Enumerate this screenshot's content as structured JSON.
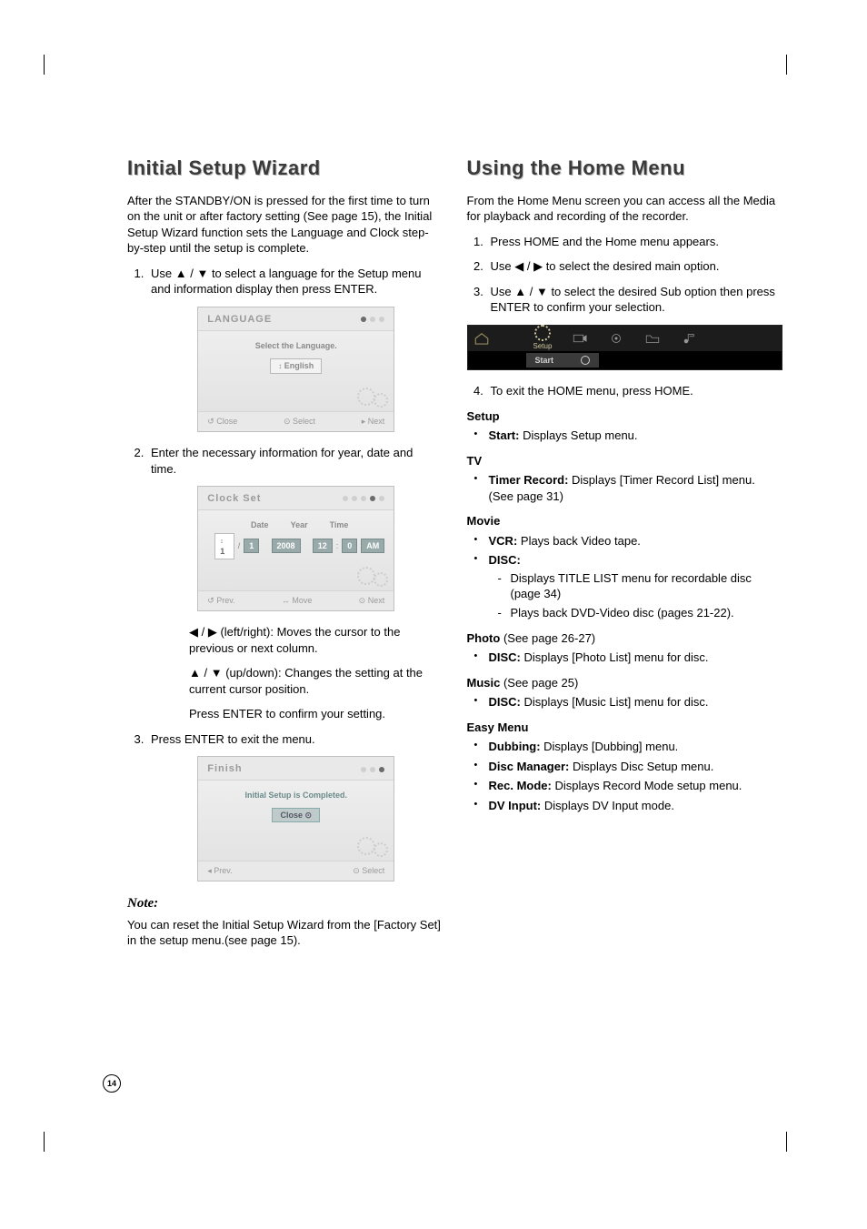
{
  "page_number": "14",
  "left": {
    "title": "Initial Setup Wizard",
    "intro": "After the STANDBY/ON is pressed for the first time to turn on the unit or after factory setting (See page 15), the Initial Setup Wizard function sets the Language and Clock step-by-step until the setup is complete.",
    "step1_a": "Use ",
    "step1_b": " to select a language for the Setup menu and information display then press ENTER.",
    "step2": "Enter the necessary information for year, date and time.",
    "cursor_lr_a": " (left/right): Moves the cursor to the previous or next column.",
    "cursor_ud_a": " (up/down): Changes the setting at the current cursor position.",
    "press_enter_confirm": "Press ENTER to confirm your setting.",
    "step3": "Press ENTER to exit the menu.",
    "note_title": "Note:",
    "note_body": "You can reset the Initial Setup Wizard from the [Factory Set] in the setup menu.(see page 15).",
    "osd1": {
      "title": "LANGUAGE",
      "prompt": "Select the Language.",
      "value": "English",
      "foot_l": "Close",
      "foot_c": "Select",
      "foot_r": "Next"
    },
    "osd2": {
      "title": "Clock Set",
      "lbl_date": "Date",
      "lbl_year": "Year",
      "lbl_time": "Time",
      "v_d1": "1",
      "v_d2": "1",
      "v_year": "2008",
      "v_h": "12",
      "v_m": "0",
      "v_ampm": "AM",
      "foot_l": "Prev.",
      "foot_c": "Move",
      "foot_r": "Next"
    },
    "osd3": {
      "title": "Finish",
      "prompt": "Initial Setup is Completed.",
      "value": "Close",
      "foot_l": "Prev.",
      "foot_r": "Select"
    }
  },
  "right": {
    "title": "Using the Home Menu",
    "intro": "From the Home Menu screen you can access all the Media for playback and recording of the recorder.",
    "s1": "Press HOME and the Home menu appears.",
    "s2_a": "Use ",
    "s2_b": " to select the desired main option.",
    "s3_a": "Use ",
    "s3_b": " to select the desired Sub option then press ENTER to confirm your selection.",
    "s4": "To exit the HOME menu, press HOME.",
    "homebar": {
      "setup": "Setup",
      "start": "Start"
    },
    "setup_h": "Setup",
    "setup_start_b": "Start:",
    "setup_start_t": " Displays Setup menu.",
    "tv_h": "TV",
    "tv_tr_b": "Timer Record:",
    "tv_tr_t": " Displays [Timer Record List] menu. (See page 31)",
    "movie_h": "Movie",
    "movie_vcr_b": "VCR:",
    "movie_vcr_t": " Plays back Video tape.",
    "movie_disc_b": "DISC:",
    "movie_disc_d1": "Displays TITLE LIST menu for recordable disc (page 34)",
    "movie_disc_d2": "Plays back DVD-Video disc (pages 21-22).",
    "photo_h": "Photo",
    "photo_h_paren": " (See page 26-27)",
    "photo_disc_b": "DISC:",
    "photo_disc_t": " Displays [Photo List] menu for disc.",
    "music_h": "Music",
    "music_h_paren": " (See page 25)",
    "music_disc_b": "DISC:",
    "music_disc_t": " Displays [Music List] menu for disc.",
    "easy_h": "Easy Menu",
    "easy_dub_b": "Dubbing:",
    "easy_dub_t": " Displays [Dubbing] menu.",
    "easy_dm_b": "Disc Manager:",
    "easy_dm_t": " Displays Disc Setup menu.",
    "easy_rm_b": "Rec. Mode:",
    "easy_rm_t": " Displays Record Mode setup menu.",
    "easy_dv_b": "DV Input:",
    "easy_dv_t": " Displays DV Input mode."
  },
  "glyph": {
    "up": "▲",
    "down": "▼",
    "left": "◀",
    "right": "▶",
    "sep": " / "
  }
}
